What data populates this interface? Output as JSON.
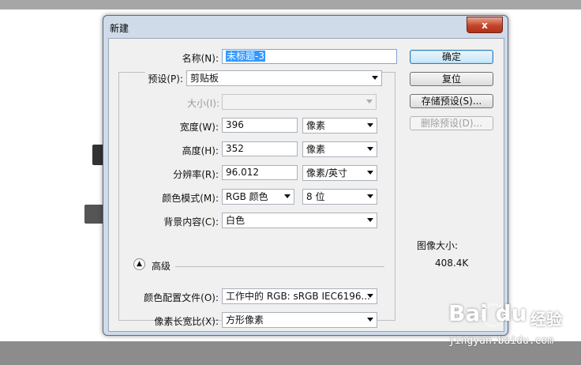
{
  "dialog": {
    "title": "新建",
    "close_label": "x",
    "name": {
      "label": "名称(N):",
      "value": "未标题-3"
    },
    "preset": {
      "label": "预设(P):",
      "value": "剪贴板"
    },
    "size": {
      "label": "大小(I):",
      "value": ""
    },
    "width": {
      "label": "宽度(W):",
      "value": "396",
      "unit": "像素"
    },
    "height": {
      "label": "高度(H):",
      "value": "352",
      "unit": "像素"
    },
    "resolution": {
      "label": "分辨率(R):",
      "value": "96.012",
      "unit": "像素/英寸"
    },
    "color_mode": {
      "label": "颜色模式(M):",
      "value": "RGB 颜色",
      "depth": "8 位"
    },
    "background": {
      "label": "背景内容(C):",
      "value": "白色"
    },
    "advanced": {
      "label": "高级",
      "icon": "double-chevron-up-icon"
    },
    "color_profile": {
      "label": "颜色配置文件(O):",
      "value": "工作中的 RGB: sRGB IEC6196..."
    },
    "pixel_aspect": {
      "label": "像素长宽比(X):",
      "value": "方形像素"
    },
    "buttons": {
      "ok": "确定",
      "reset": "复位",
      "save_preset": "存储预设(S)...",
      "delete_preset": "删除预设(D)..."
    },
    "image_size": {
      "label": "图像大小:",
      "value": "408.4K"
    }
  },
  "watermark": {
    "logo": "Bai du",
    "text": "经验",
    "url": "jingyan.baidu.com"
  }
}
